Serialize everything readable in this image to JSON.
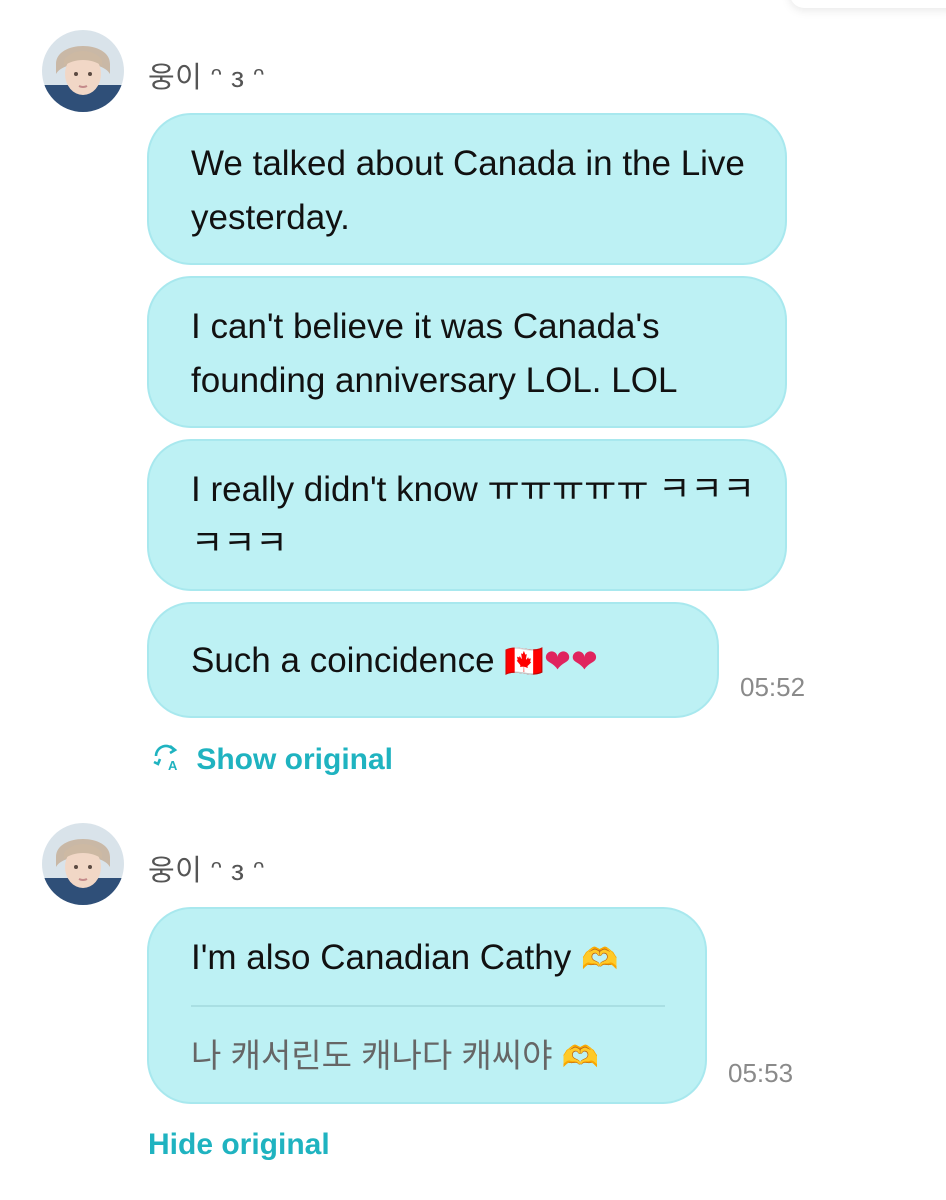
{
  "messages": [
    {
      "sender": "웅이 ᵔ ᴈ ᵔ",
      "bubbles": [
        "We talked about Canada in the Live yesterday.",
        "I can't believe it was Canada's founding anniversary LOL. LOL",
        "I really didn't know ㅠㅠㅠㅠㅠ ㅋㅋㅋㅋㅋㅋ",
        "Such a coincidence"
      ],
      "last_emoji": "🇨🇦❤❤",
      "time": "05:52",
      "toggle_label": "Show original"
    },
    {
      "sender": "웅이 ᵔ ᴈ ᵔ",
      "translated": "I'm also Canadian Cathy",
      "original": "나 캐서린도 캐나다 캐씨야",
      "hand_emoji": "🫶",
      "time": "05:53",
      "toggle_label": "Hide original"
    }
  ],
  "icons": {
    "avatar": "avatar",
    "translate": "translate-icon"
  },
  "colors": {
    "bubble": "#bdf1f4",
    "bubble_border": "#a8e8ee",
    "link": "#1fb3c0",
    "time": "#8a8a8a"
  }
}
